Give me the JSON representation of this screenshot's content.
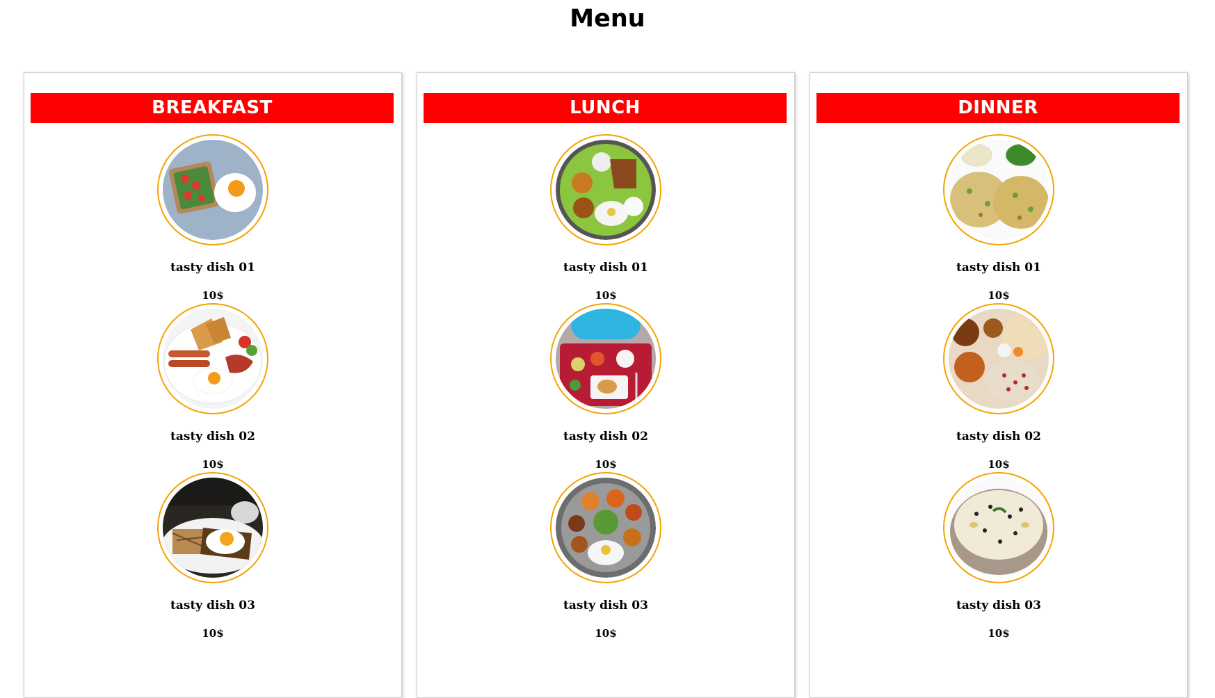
{
  "page": {
    "title": "Menu"
  },
  "columns": [
    {
      "heading": "BREAKFAST",
      "dishes": [
        {
          "name": "tasty dish 01",
          "price": "10$",
          "icon": "toast-and-egg-photo"
        },
        {
          "name": "tasty dish 02",
          "price": "10$",
          "icon": "sausage-bacon-egg-photo"
        },
        {
          "name": "tasty dish 03",
          "price": "10$",
          "icon": "egg-on-toast-photo"
        }
      ]
    },
    {
      "heading": "LUNCH",
      "dishes": [
        {
          "name": "tasty dish 01",
          "price": "10$",
          "icon": "thali-plate-photo"
        },
        {
          "name": "tasty dish 02",
          "price": "10$",
          "icon": "lunch-tray-photo"
        },
        {
          "name": "tasty dish 03",
          "price": "10$",
          "icon": "steel-thali-photo"
        }
      ]
    },
    {
      "heading": "DINNER",
      "dishes": [
        {
          "name": "tasty dish 01",
          "price": "10$",
          "icon": "pancake-chutney-photo"
        },
        {
          "name": "tasty dish 02",
          "price": "10$",
          "icon": "rice-curry-platter-photo"
        },
        {
          "name": "tasty dish 03",
          "price": "10$",
          "icon": "rice-bowl-photo"
        }
      ]
    }
  ],
  "colors": {
    "header_bg": "#ff0000",
    "header_text": "#ffffff",
    "photo_ring": "#f5a300"
  }
}
